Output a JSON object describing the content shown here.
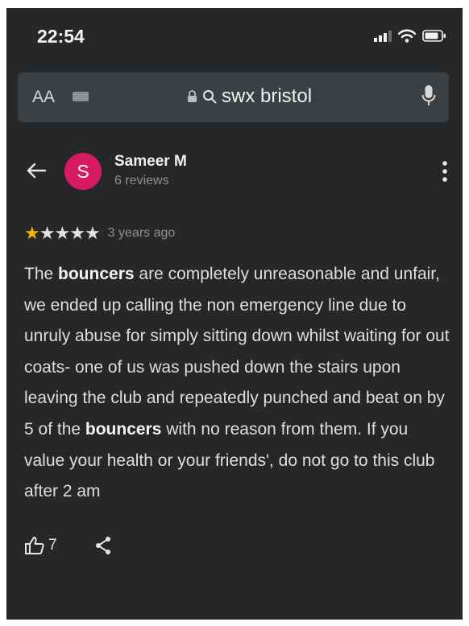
{
  "status_bar": {
    "time": "22:54",
    "icons": [
      "signal-icon",
      "wifi-icon",
      "battery-icon"
    ]
  },
  "browser": {
    "text_size_label": "AA",
    "url": "swx bristol",
    "icons": [
      "tab-badge-icon",
      "lock-icon",
      "search-icon",
      "microphone-icon"
    ]
  },
  "review": {
    "back_icon": "back-arrow-icon",
    "avatar_letter": "S",
    "reviewer_name": "Sameer M",
    "reviewer_reviews": "6 reviews",
    "more_icon": "more-vert-icon",
    "rating": 1,
    "rating_max": 5,
    "date": "3 years ago",
    "text": {
      "p1": "The ",
      "b1": "bouncers",
      "p2": " are completely unreasonable and unfair, we ended up calling the non emergency line due to unruly abuse for simply sitting down whilst waiting for out coats- one of us was pushed down the stairs upon leaving the club and repeatedly punched and beat on by 5 of the ",
      "b2": "bouncers",
      "p3": " with no reason from them. If you value your health or your friends', do not go to this club after 2 am"
    },
    "likes": "7",
    "like_icon": "thumbs-up-icon",
    "share_icon": "share-icon"
  },
  "colors": {
    "background": "#252729",
    "address_bar": "#3d4043",
    "avatar": "#d81b60",
    "star_filled": "#f2b600",
    "text": "#dedede",
    "muted": "#8d8f92"
  }
}
